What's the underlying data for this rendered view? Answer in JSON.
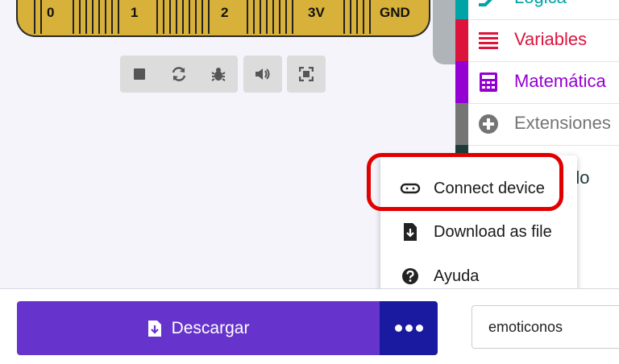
{
  "simulator": {
    "pins": [
      "0",
      "1",
      "2",
      "3V",
      "GND"
    ],
    "toolbar": [
      {
        "icon": "stop-icon"
      },
      {
        "icon": "restart-icon"
      },
      {
        "icon": "debug-icon"
      },
      {
        "icon": "sound-icon"
      },
      {
        "icon": "fullscreen-icon"
      }
    ]
  },
  "toolbox": {
    "categories": [
      {
        "label": "Lógica",
        "color": "#00a4a6",
        "icon": "logic-icon"
      },
      {
        "label": "Variables",
        "color": "#dc143c",
        "icon": "variables-icon"
      },
      {
        "label": "Matemática",
        "color": "#9400d3",
        "icon": "calculator-icon"
      },
      {
        "label": "Extensiones",
        "color": "#757575",
        "icon": "plus-circle-icon"
      },
      {
        "label": "do",
        "color": "#1a3d3a",
        "icon": "advanced-icon"
      }
    ]
  },
  "menu": {
    "items": [
      {
        "label": "Connect device",
        "icon": "usb-connect-icon"
      },
      {
        "label": "Download as file",
        "icon": "file-download-icon"
      },
      {
        "label": "Ayuda",
        "icon": "help-icon"
      }
    ]
  },
  "bottom": {
    "download_label": "Descargar",
    "project_name": "emoticonos"
  },
  "colors": {
    "download": "#6633cc",
    "more": "#1a1aa0",
    "highlight": "#e00000"
  }
}
